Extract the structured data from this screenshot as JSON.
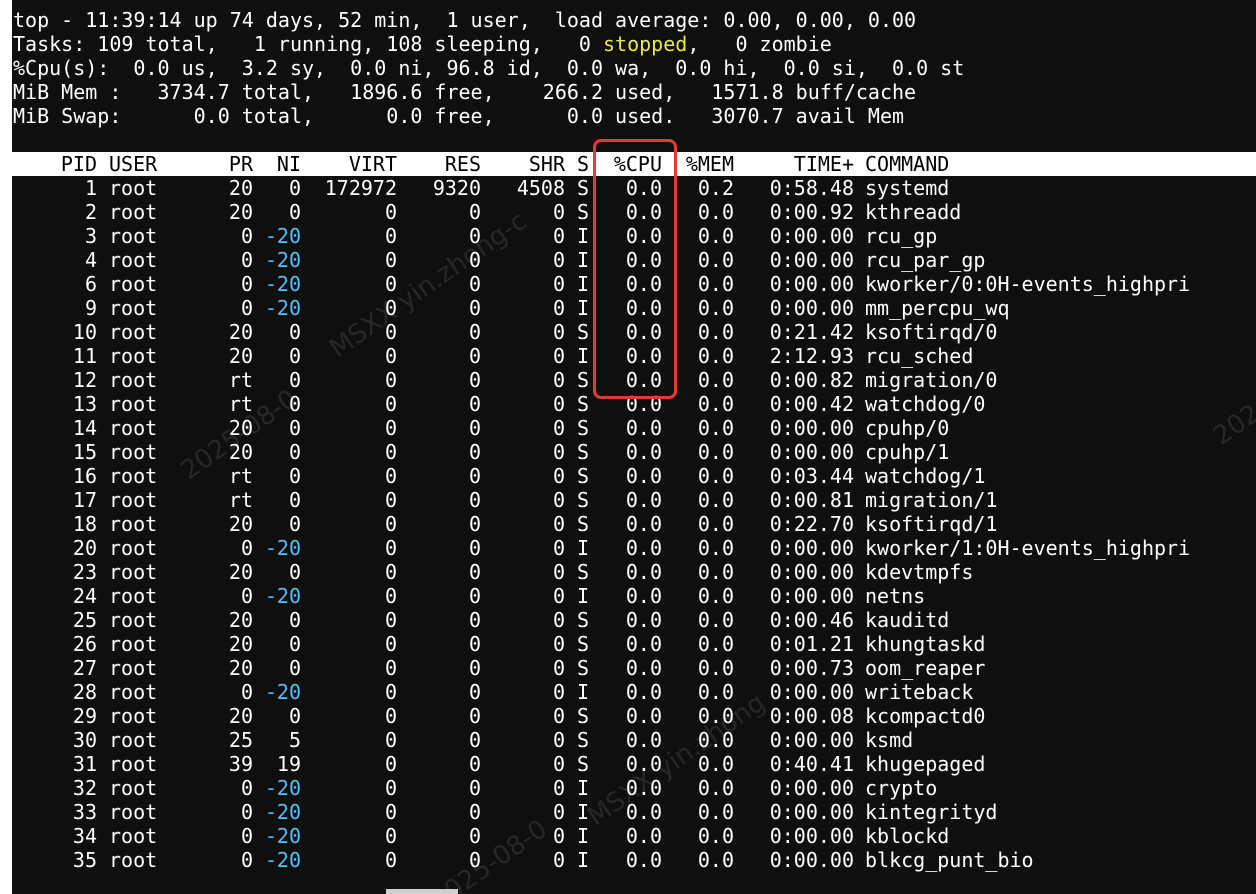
{
  "summary": {
    "line1": "top - 11:39:14 up 74 days, 52 min,  1 user,  load average: 0.00, 0.00, 0.00",
    "tasks_prefix": "Tasks: 109 total,   1 running, 108 sleeping,   0 ",
    "tasks_stopped": "stopped",
    "tasks_suffix": ",   0 zombie",
    "cpu": "%Cpu(s):  0.0 us,  3.2 sy,  0.0 ni, 96.8 id,  0.0 wa,  0.0 hi,  0.0 si,  0.0 st",
    "mem": "MiB Mem :   3734.7 total,   1896.6 free,    266.2 used,   1571.8 buff/cache",
    "swap": "MiB Swap:      0.0 total,      0.0 free,      0.0 used.   3070.7 avail Mem"
  },
  "columns": {
    "pid": "PID",
    "user": "USER",
    "pr": "PR",
    "ni": "NI",
    "virt": "VIRT",
    "res": "RES",
    "shr": "SHR",
    "s": "S",
    "cpu": "%CPU",
    "mem": "%MEM",
    "time": "TIME+",
    "command": "COMMAND"
  },
  "processes": [
    {
      "pid": "1",
      "user": "root",
      "pr": "20",
      "ni": "0",
      "virt": "172972",
      "res": "9320",
      "shr": "4508",
      "s": "S",
      "cpu": "0.0",
      "mem": "0.2",
      "time": "0:58.48",
      "command": "systemd"
    },
    {
      "pid": "2",
      "user": "root",
      "pr": "20",
      "ni": "0",
      "virt": "0",
      "res": "0",
      "shr": "0",
      "s": "S",
      "cpu": "0.0",
      "mem": "0.0",
      "time": "0:00.92",
      "command": "kthreadd"
    },
    {
      "pid": "3",
      "user": "root",
      "pr": "0",
      "ni": "-20",
      "virt": "0",
      "res": "0",
      "shr": "0",
      "s": "I",
      "cpu": "0.0",
      "mem": "0.0",
      "time": "0:00.00",
      "command": "rcu_gp"
    },
    {
      "pid": "4",
      "user": "root",
      "pr": "0",
      "ni": "-20",
      "virt": "0",
      "res": "0",
      "shr": "0",
      "s": "I",
      "cpu": "0.0",
      "mem": "0.0",
      "time": "0:00.00",
      "command": "rcu_par_gp"
    },
    {
      "pid": "6",
      "user": "root",
      "pr": "0",
      "ni": "-20",
      "virt": "0",
      "res": "0",
      "shr": "0",
      "s": "I",
      "cpu": "0.0",
      "mem": "0.0",
      "time": "0:00.00",
      "command": "kworker/0:0H-events_highpri"
    },
    {
      "pid": "9",
      "user": "root",
      "pr": "0",
      "ni": "-20",
      "virt": "0",
      "res": "0",
      "shr": "0",
      "s": "I",
      "cpu": "0.0",
      "mem": "0.0",
      "time": "0:00.00",
      "command": "mm_percpu_wq"
    },
    {
      "pid": "10",
      "user": "root",
      "pr": "20",
      "ni": "0",
      "virt": "0",
      "res": "0",
      "shr": "0",
      "s": "S",
      "cpu": "0.0",
      "mem": "0.0",
      "time": "0:21.42",
      "command": "ksoftirqd/0"
    },
    {
      "pid": "11",
      "user": "root",
      "pr": "20",
      "ni": "0",
      "virt": "0",
      "res": "0",
      "shr": "0",
      "s": "I",
      "cpu": "0.0",
      "mem": "0.0",
      "time": "2:12.93",
      "command": "rcu_sched"
    },
    {
      "pid": "12",
      "user": "root",
      "pr": "rt",
      "ni": "0",
      "virt": "0",
      "res": "0",
      "shr": "0",
      "s": "S",
      "cpu": "0.0",
      "mem": "0.0",
      "time": "0:00.82",
      "command": "migration/0"
    },
    {
      "pid": "13",
      "user": "root",
      "pr": "rt",
      "ni": "0",
      "virt": "0",
      "res": "0",
      "shr": "0",
      "s": "S",
      "cpu": "0.0",
      "mem": "0.0",
      "time": "0:00.42",
      "command": "watchdog/0"
    },
    {
      "pid": "14",
      "user": "root",
      "pr": "20",
      "ni": "0",
      "virt": "0",
      "res": "0",
      "shr": "0",
      "s": "S",
      "cpu": "0.0",
      "mem": "0.0",
      "time": "0:00.00",
      "command": "cpuhp/0"
    },
    {
      "pid": "15",
      "user": "root",
      "pr": "20",
      "ni": "0",
      "virt": "0",
      "res": "0",
      "shr": "0",
      "s": "S",
      "cpu": "0.0",
      "mem": "0.0",
      "time": "0:00.00",
      "command": "cpuhp/1"
    },
    {
      "pid": "16",
      "user": "root",
      "pr": "rt",
      "ni": "0",
      "virt": "0",
      "res": "0",
      "shr": "0",
      "s": "S",
      "cpu": "0.0",
      "mem": "0.0",
      "time": "0:03.44",
      "command": "watchdog/1"
    },
    {
      "pid": "17",
      "user": "root",
      "pr": "rt",
      "ni": "0",
      "virt": "0",
      "res": "0",
      "shr": "0",
      "s": "S",
      "cpu": "0.0",
      "mem": "0.0",
      "time": "0:00.81",
      "command": "migration/1"
    },
    {
      "pid": "18",
      "user": "root",
      "pr": "20",
      "ni": "0",
      "virt": "0",
      "res": "0",
      "shr": "0",
      "s": "S",
      "cpu": "0.0",
      "mem": "0.0",
      "time": "0:22.70",
      "command": "ksoftirqd/1"
    },
    {
      "pid": "20",
      "user": "root",
      "pr": "0",
      "ni": "-20",
      "virt": "0",
      "res": "0",
      "shr": "0",
      "s": "I",
      "cpu": "0.0",
      "mem": "0.0",
      "time": "0:00.00",
      "command": "kworker/1:0H-events_highpri"
    },
    {
      "pid": "23",
      "user": "root",
      "pr": "20",
      "ni": "0",
      "virt": "0",
      "res": "0",
      "shr": "0",
      "s": "S",
      "cpu": "0.0",
      "mem": "0.0",
      "time": "0:00.00",
      "command": "kdevtmpfs"
    },
    {
      "pid": "24",
      "user": "root",
      "pr": "0",
      "ni": "-20",
      "virt": "0",
      "res": "0",
      "shr": "0",
      "s": "I",
      "cpu": "0.0",
      "mem": "0.0",
      "time": "0:00.00",
      "command": "netns"
    },
    {
      "pid": "25",
      "user": "root",
      "pr": "20",
      "ni": "0",
      "virt": "0",
      "res": "0",
      "shr": "0",
      "s": "S",
      "cpu": "0.0",
      "mem": "0.0",
      "time": "0:00.46",
      "command": "kauditd"
    },
    {
      "pid": "26",
      "user": "root",
      "pr": "20",
      "ni": "0",
      "virt": "0",
      "res": "0",
      "shr": "0",
      "s": "S",
      "cpu": "0.0",
      "mem": "0.0",
      "time": "0:01.21",
      "command": "khungtaskd"
    },
    {
      "pid": "27",
      "user": "root",
      "pr": "20",
      "ni": "0",
      "virt": "0",
      "res": "0",
      "shr": "0",
      "s": "S",
      "cpu": "0.0",
      "mem": "0.0",
      "time": "0:00.73",
      "command": "oom_reaper"
    },
    {
      "pid": "28",
      "user": "root",
      "pr": "0",
      "ni": "-20",
      "virt": "0",
      "res": "0",
      "shr": "0",
      "s": "I",
      "cpu": "0.0",
      "mem": "0.0",
      "time": "0:00.00",
      "command": "writeback"
    },
    {
      "pid": "29",
      "user": "root",
      "pr": "20",
      "ni": "0",
      "virt": "0",
      "res": "0",
      "shr": "0",
      "s": "S",
      "cpu": "0.0",
      "mem": "0.0",
      "time": "0:00.08",
      "command": "kcompactd0"
    },
    {
      "pid": "30",
      "user": "root",
      "pr": "25",
      "ni": "5",
      "virt": "0",
      "res": "0",
      "shr": "0",
      "s": "S",
      "cpu": "0.0",
      "mem": "0.0",
      "time": "0:00.00",
      "command": "ksmd"
    },
    {
      "pid": "31",
      "user": "root",
      "pr": "39",
      "ni": "19",
      "virt": "0",
      "res": "0",
      "shr": "0",
      "s": "S",
      "cpu": "0.0",
      "mem": "0.0",
      "time": "0:40.41",
      "command": "khugepaged"
    },
    {
      "pid": "32",
      "user": "root",
      "pr": "0",
      "ni": "-20",
      "virt": "0",
      "res": "0",
      "shr": "0",
      "s": "I",
      "cpu": "0.0",
      "mem": "0.0",
      "time": "0:00.00",
      "command": "crypto"
    },
    {
      "pid": "33",
      "user": "root",
      "pr": "0",
      "ni": "-20",
      "virt": "0",
      "res": "0",
      "shr": "0",
      "s": "I",
      "cpu": "0.0",
      "mem": "0.0",
      "time": "0:00.00",
      "command": "kintegrityd"
    },
    {
      "pid": "34",
      "user": "root",
      "pr": "0",
      "ni": "-20",
      "virt": "0",
      "res": "0",
      "shr": "0",
      "s": "I",
      "cpu": "0.0",
      "mem": "0.0",
      "time": "0:00.00",
      "command": "kblockd"
    },
    {
      "pid": "35",
      "user": "root",
      "pr": "0",
      "ni": "-20",
      "virt": "0",
      "res": "0",
      "shr": "0",
      "s": "I",
      "cpu": "0.0",
      "mem": "0.0",
      "time": "0:00.00",
      "command": "blkcg_punt_bio"
    }
  ],
  "watermarks": [
    "MSXX yin.zhong-c",
    "2025-08-0",
    "MSXX yin.zhong",
    "2025-08-0",
    "202"
  ],
  "colors": {
    "background": "#0f0f0f",
    "text": "#ffffff",
    "header_bg": "#ffffff",
    "header_text": "#000000",
    "stopped": "#e8e84a",
    "negative_nice": "#4fc3f7",
    "highlight": "#e53935"
  }
}
